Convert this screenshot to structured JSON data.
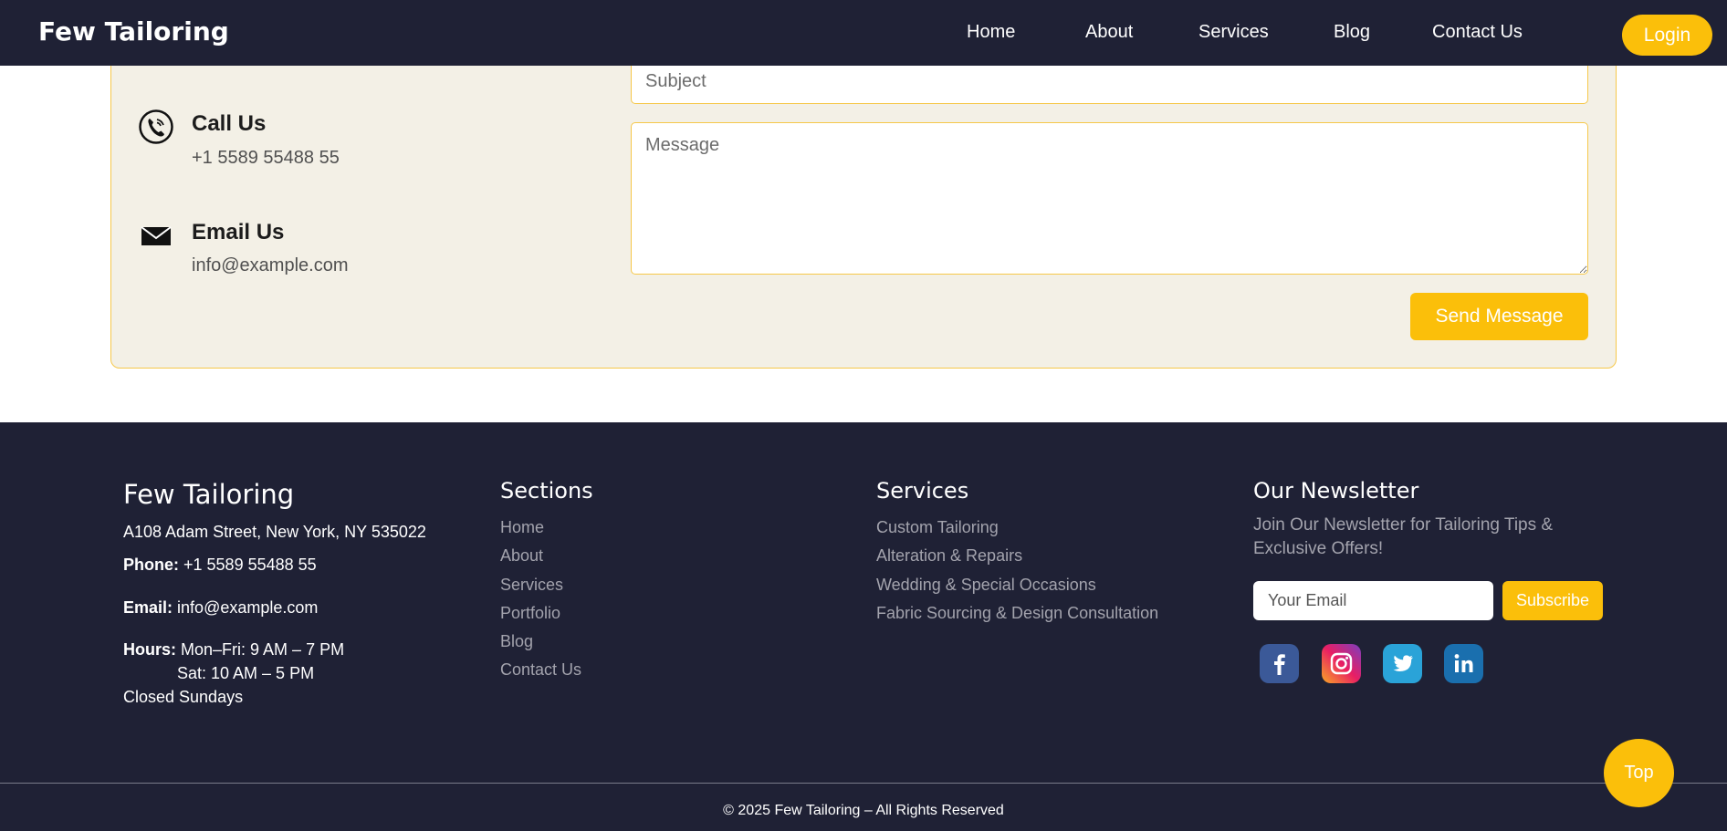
{
  "navbar": {
    "brand": "Few Tailoring",
    "links": [
      "Home",
      "About",
      "Services",
      "Blog",
      "Contact Us"
    ],
    "login_label": "Login"
  },
  "contact": {
    "call_title": "Call Us",
    "call_value": "+1 5589 55488 55",
    "email_title": "Email Us",
    "email_value": "info@example.com",
    "subject_placeholder": "Subject",
    "message_placeholder": "Message",
    "send_label": "Send Message"
  },
  "footer": {
    "brand": "Few Tailoring",
    "address": "A108 Adam Street, New York, NY 535022",
    "phone_label": "Phone:",
    "phone_value": "+1 5589 55488 55",
    "email_label": "Email:",
    "email_value": "info@example.com",
    "hours_label": "Hours:",
    "hours_line1": "Mon–Fri: 9 AM – 7 PM",
    "hours_line2": "Sat: 10 AM – 5 PM",
    "hours_line3": "Closed Sundays",
    "sections_heading": "Sections",
    "sections": [
      "Home",
      "About",
      "Services",
      "Portfolio",
      "Blog",
      "Contact Us"
    ],
    "services_heading": "Services",
    "services": [
      "Custom Tailoring",
      "Alteration & Repairs",
      "Wedding & Special Occasions",
      "Fabric Sourcing & Design Consultation"
    ],
    "newsletter_heading": "Our Newsletter",
    "newsletter_text": "Join Our Newsletter for Tailoring Tips & Exclusive Offers!",
    "email_placeholder": "Your Email",
    "subscribe_label": "Subscribe",
    "social_icons": [
      "facebook-icon",
      "instagram-icon",
      "twitter-icon",
      "linkedin-icon"
    ],
    "copyright": "© 2025 Few Tailoring – All Rights Reserved"
  },
  "top_button_label": "Top",
  "colors": {
    "navy": "#1f2135",
    "accent": "#fbbf0a",
    "card_bg": "#f3f0e6",
    "muted_text": "#a3a3ad"
  }
}
